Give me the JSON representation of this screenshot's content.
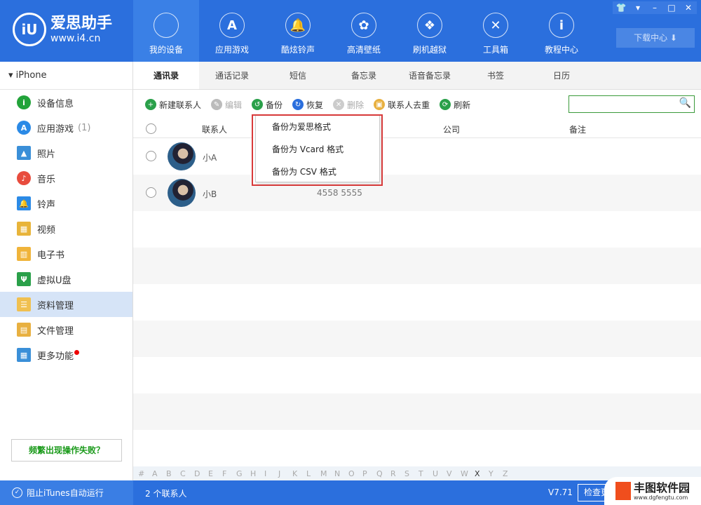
{
  "app": {
    "logo_mark": "iU",
    "name": "爱思助手",
    "url": "www.i4.cn"
  },
  "nav": [
    {
      "label": "我的设备",
      "icon": "apple-icon",
      "glyph": ""
    },
    {
      "label": "应用游戏",
      "icon": "app-store-icon",
      "glyph": "A"
    },
    {
      "label": "酷炫铃声",
      "icon": "bell-icon",
      "glyph": "🔔"
    },
    {
      "label": "高清壁纸",
      "icon": "flower-icon",
      "glyph": "✿"
    },
    {
      "label": "刷机越狱",
      "icon": "box-icon",
      "glyph": "❖"
    },
    {
      "label": "工具箱",
      "icon": "tools-icon",
      "glyph": "✕"
    },
    {
      "label": "教程中心",
      "icon": "info-icon",
      "glyph": "i"
    }
  ],
  "window_controls": {
    "skin": "👕",
    "menu": "▾",
    "minimize": "–",
    "maximize": "□",
    "close": "✕"
  },
  "download_center": "下载中心 ⬇",
  "device": "▾  iPhone",
  "sidebar": {
    "items": [
      {
        "label": "设备信息",
        "color": "#22a33a",
        "glyph": "i"
      },
      {
        "label": "应用游戏",
        "color": "#2b8ae6",
        "glyph": "A",
        "count": "(1)"
      },
      {
        "label": "照片",
        "color": "#3a8fd8",
        "glyph": "▲"
      },
      {
        "label": "音乐",
        "color": "#e84c3d",
        "glyph": "♪"
      },
      {
        "label": "铃声",
        "color": "#2b8ae6",
        "glyph": "🔔"
      },
      {
        "label": "视频",
        "color": "#e8b43a",
        "glyph": "▦"
      },
      {
        "label": "电子书",
        "color": "#f0b43a",
        "glyph": "▥"
      },
      {
        "label": "虚拟U盘",
        "color": "#2aa04a",
        "glyph": "Ψ"
      },
      {
        "label": "资料管理",
        "color": "#f0c050",
        "glyph": "☰"
      },
      {
        "label": "文件管理",
        "color": "#e8b040",
        "glyph": "▤"
      },
      {
        "label": "更多功能",
        "color": "#3a8fd8",
        "glyph": "▦",
        "badge": true
      }
    ],
    "fail_button": "频繁出现操作失败？"
  },
  "tabs": [
    "通讯录",
    "通话记录",
    "短信",
    "备忘录",
    "语音备忘录",
    "书签",
    "日历"
  ],
  "toolbar": [
    {
      "label": "新建联系人",
      "color": "#2aa04a",
      "glyph": "+",
      "disabled": false
    },
    {
      "label": "编辑",
      "color": "#bbb",
      "glyph": "✎",
      "disabled": true
    },
    {
      "label": "备份",
      "color": "#2aa04a",
      "glyph": "↺",
      "disabled": false
    },
    {
      "label": "恢复",
      "color": "#2b6fdd",
      "glyph": "↻",
      "disabled": false
    },
    {
      "label": "删除",
      "color": "#ccc",
      "glyph": "✕",
      "disabled": true
    },
    {
      "label": "联系人去重",
      "color": "#e8b040",
      "glyph": "▣",
      "disabled": false
    },
    {
      "label": "刷新",
      "color": "#2aa04a",
      "glyph": "⟳",
      "disabled": false
    }
  ],
  "search": {
    "placeholder": "",
    "icon": "🔍"
  },
  "columns": {
    "contact": "联系人",
    "company": "公司",
    "note": "备注"
  },
  "contacts": [
    {
      "name": "小A",
      "phone": ""
    },
    {
      "name": "小B",
      "phone": "4558 5555"
    }
  ],
  "backup_menu": [
    "备份为爱思格式",
    "备份为 Vcard 格式",
    "备份为 CSV 格式"
  ],
  "alphabet": [
    "#",
    "A",
    "B",
    "C",
    "D",
    "E",
    "F",
    "G",
    "H",
    "I",
    "J",
    "K",
    "L",
    "M",
    "N",
    "O",
    "P",
    "Q",
    "R",
    "S",
    "T",
    "U",
    "V",
    "W",
    "X",
    "Y",
    "Z"
  ],
  "alphabet_active": "X",
  "status": {
    "itunes": "阻止iTunes自动运行",
    "count": "2 个联系人",
    "version": "V7.71",
    "update": "检查更新"
  },
  "watermark": {
    "name": "丰图软件园",
    "url": "www.dgfengtu.com"
  }
}
